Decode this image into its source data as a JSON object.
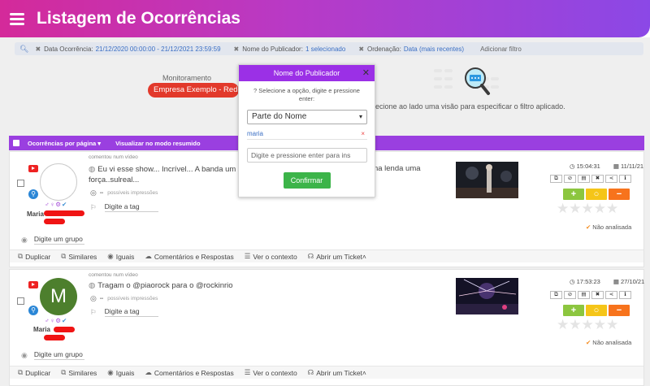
{
  "header": {
    "title": "Listagem de Ocorrências"
  },
  "filters": [
    {
      "label": "Data Ocorrência:",
      "value": "21/12/2020 00:00:00 - 21/12/2021 23:59:59"
    },
    {
      "label": "Nome do Publicador:",
      "value": "1 selecionado"
    },
    {
      "label": "Ordenação:",
      "value": "Data (mais recentes)"
    }
  ],
  "add_filter": "Adicionar filtro",
  "monitoramento": {
    "label": "Monitoramento",
    "value": "Empresa Exemplo - Rede"
  },
  "empty_hint": "lecione ao lado uma visão para especificar o filtro aplicado.",
  "toolbar": {
    "per_page": "Ocorrências por página",
    "summary_mode": "Visualizar no modo resumido"
  },
  "popup": {
    "title": "Nome do Publicador",
    "instructions": "Selecione a opção, digite e pressione enter:",
    "select_value": "Parte do Nome",
    "chip": "maria",
    "input_placeholder": "Digite e pressione enter para ins",
    "confirm": "Confirmar"
  },
  "footer_actions": [
    "Duplicar",
    "Similares",
    "Iguais",
    "Comentários e Respostas",
    "Ver o contexto",
    "Abrir um Ticket"
  ],
  "cards": [
    {
      "source_note": "comentou num vídeo",
      "text": "Eu vi esse show... Incrível... A banda um absu",
      "text_cont": "nem é uma lenda uma",
      "text2": "força..sulreal...",
      "impressions": "possíveis impressões",
      "impressions_value": "--",
      "tag_placeholder": "Digite a tag",
      "group_placeholder": "Digite um grupo",
      "author": "Maria",
      "time": "15:04:31",
      "date": "11/11/21",
      "status": "Não analisada",
      "avatar_letter": ""
    },
    {
      "source_note": "comentou num vídeo",
      "text": "Tragam o @piaorock para o @rockinrio",
      "text_cont": "",
      "text2": "",
      "impressions": "possíveis impressões",
      "impressions_value": "--",
      "tag_placeholder": "Digite a tag",
      "group_placeholder": "Digite um grupo",
      "author": "Maria",
      "time": "17:53:23",
      "date": "27/10/21",
      "status": "Não analisada",
      "avatar_letter": "M"
    }
  ],
  "colors": {
    "accent": "#9b30e6",
    "header_start": "#d42a9a",
    "confirm": "#3cb449",
    "positive": "#8cc63f",
    "neutral": "#f5c518",
    "negative": "#f7731c"
  }
}
